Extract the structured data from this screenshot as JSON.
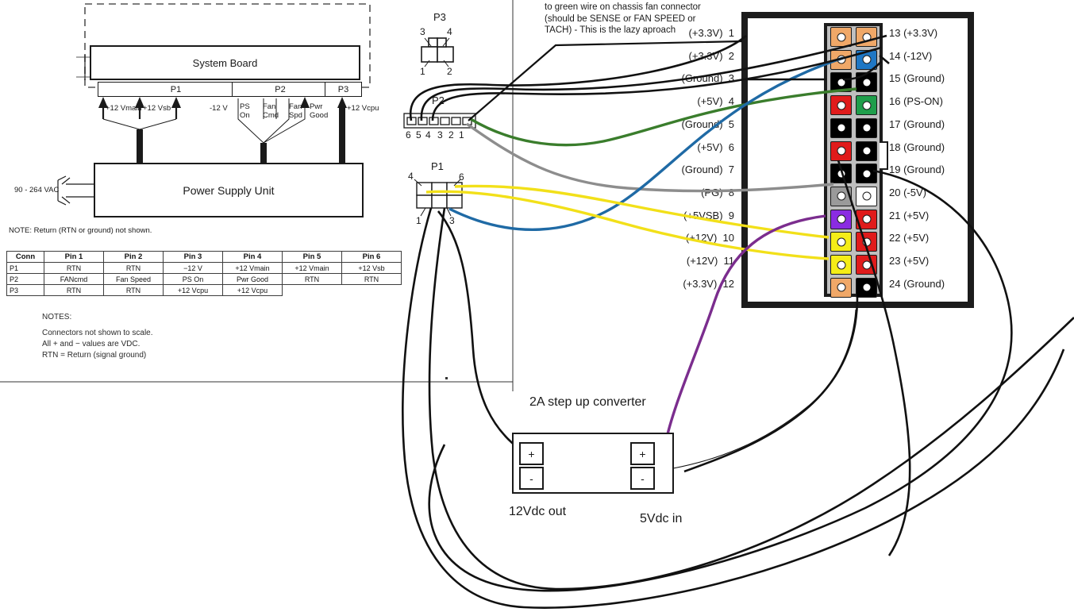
{
  "annotation": {
    "line1": "to green wire on chassis fan connector",
    "line2": "(should be SENSE or FAN SPEED or",
    "line3": " TACH) - This is the lazy aproach"
  },
  "block_diagram": {
    "system_board_label": "System Board",
    "psu_label": "Power Supply Unit",
    "ac_input_label": "90 - 264 VAC",
    "note": "NOTE: Return (RTN or ground) not shown.",
    "connectors": [
      {
        "name": "P1"
      },
      {
        "name": "P2"
      },
      {
        "name": "P3"
      }
    ],
    "p1_rail_labels": [
      "+12 Vmain",
      "+12 Vsb",
      "-12 V"
    ],
    "p2_signal_labels": [
      "PS\nOn",
      "Fan\nCmd",
      "Fan\nSpd",
      "Pwr\nGood"
    ],
    "p3_rail_label": "+12 Vcpu"
  },
  "pin_table": {
    "headers": [
      "Conn",
      "Pin 1",
      "Pin 2",
      "Pin 3",
      "Pin 4",
      "Pin 5",
      "Pin 6"
    ],
    "rows": [
      {
        "conn": "P1",
        "cells": [
          "RTN",
          "RTN",
          "−12 V",
          "+12 Vmain",
          "+12 Vmain",
          "+12 Vsb"
        ]
      },
      {
        "conn": "P2",
        "cells": [
          "FANcmd",
          "Fan Speed",
          "PS On",
          "Pwr Good",
          "RTN",
          "RTN"
        ]
      },
      {
        "conn": "P3",
        "cells": [
          "RTN",
          "RTN",
          "+12 Vcpu",
          "+12 Vcpu",
          "",
          ""
        ]
      }
    ]
  },
  "notes": {
    "heading": "NOTES:",
    "lines": [
      "Connectors not shown to scale.",
      "All + and − values are VDC.",
      "RTN = Return (signal ground)"
    ]
  },
  "mid_connectors": {
    "p3": {
      "label": "P3",
      "pins": [
        "3",
        "4",
        "1",
        "2"
      ]
    },
    "p2": {
      "label": "P2",
      "pins": [
        "6",
        "5",
        "4",
        "3",
        "2",
        "1"
      ]
    },
    "p1": {
      "label": "P1",
      "pins": [
        "4",
        "6",
        "1",
        "3"
      ]
    }
  },
  "atx": {
    "left_pins": [
      {
        "num": "1",
        "label": "(+3.3V)",
        "color": "#f0a868"
      },
      {
        "num": "2",
        "label": "(+3.3V)",
        "color": "#f0a868"
      },
      {
        "num": "3",
        "label": "(Ground)",
        "color": "#000000"
      },
      {
        "num": "4",
        "label": "(+5V)",
        "color": "#e01b1b"
      },
      {
        "num": "5",
        "label": "(Ground)",
        "color": "#000000"
      },
      {
        "num": "6",
        "label": "(+5V)",
        "color": "#e01b1b"
      },
      {
        "num": "7",
        "label": "(Ground)",
        "color": "#000000"
      },
      {
        "num": "8",
        "label": "(PG)",
        "color": "#9a9a9a"
      },
      {
        "num": "9",
        "label": "(+5VSB)",
        "color": "#8a2be2"
      },
      {
        "num": "10",
        "label": "(+12V)",
        "color": "#f5ed17"
      },
      {
        "num": "11",
        "label": "(+12V)",
        "color": "#f5ed17"
      },
      {
        "num": "12",
        "label": "(+3.3V)",
        "color": "#f0a868"
      }
    ],
    "right_pins": [
      {
        "num": "13",
        "label": "(+3.3V)",
        "color": "#f0a868"
      },
      {
        "num": "14",
        "label": "(-12V)",
        "color": "#1f77c4"
      },
      {
        "num": "15",
        "label": "(Ground)",
        "color": "#000000"
      },
      {
        "num": "16",
        "label": "(PS-ON)",
        "color": "#1f9e4b"
      },
      {
        "num": "17",
        "label": "(Ground)",
        "color": "#000000"
      },
      {
        "num": "18",
        "label": "(Ground)",
        "color": "#000000"
      },
      {
        "num": "19",
        "label": "(Ground)",
        "color": "#000000"
      },
      {
        "num": "20",
        "label": "(-5V)",
        "color": "#ffffff"
      },
      {
        "num": "21",
        "label": "(+5V)",
        "color": "#e01b1b"
      },
      {
        "num": "22",
        "label": "(+5V)",
        "color": "#e01b1b"
      },
      {
        "num": "23",
        "label": "(+5V)",
        "color": "#e01b1b"
      },
      {
        "num": "24",
        "label": "(Ground)",
        "color": "#000000"
      }
    ]
  },
  "converter": {
    "title": "2A step up converter",
    "output_label": "12Vdc out",
    "input_label": "5Vdc in",
    "pad_plus": "+",
    "pad_minus": "-"
  },
  "wire_colors": {
    "green": "#3a7d2c",
    "blue": "#1f6aa5",
    "gray": "#8d8d8d",
    "yellow": "#f2e019",
    "purple": "#7b2d8e",
    "black": "#111111"
  }
}
